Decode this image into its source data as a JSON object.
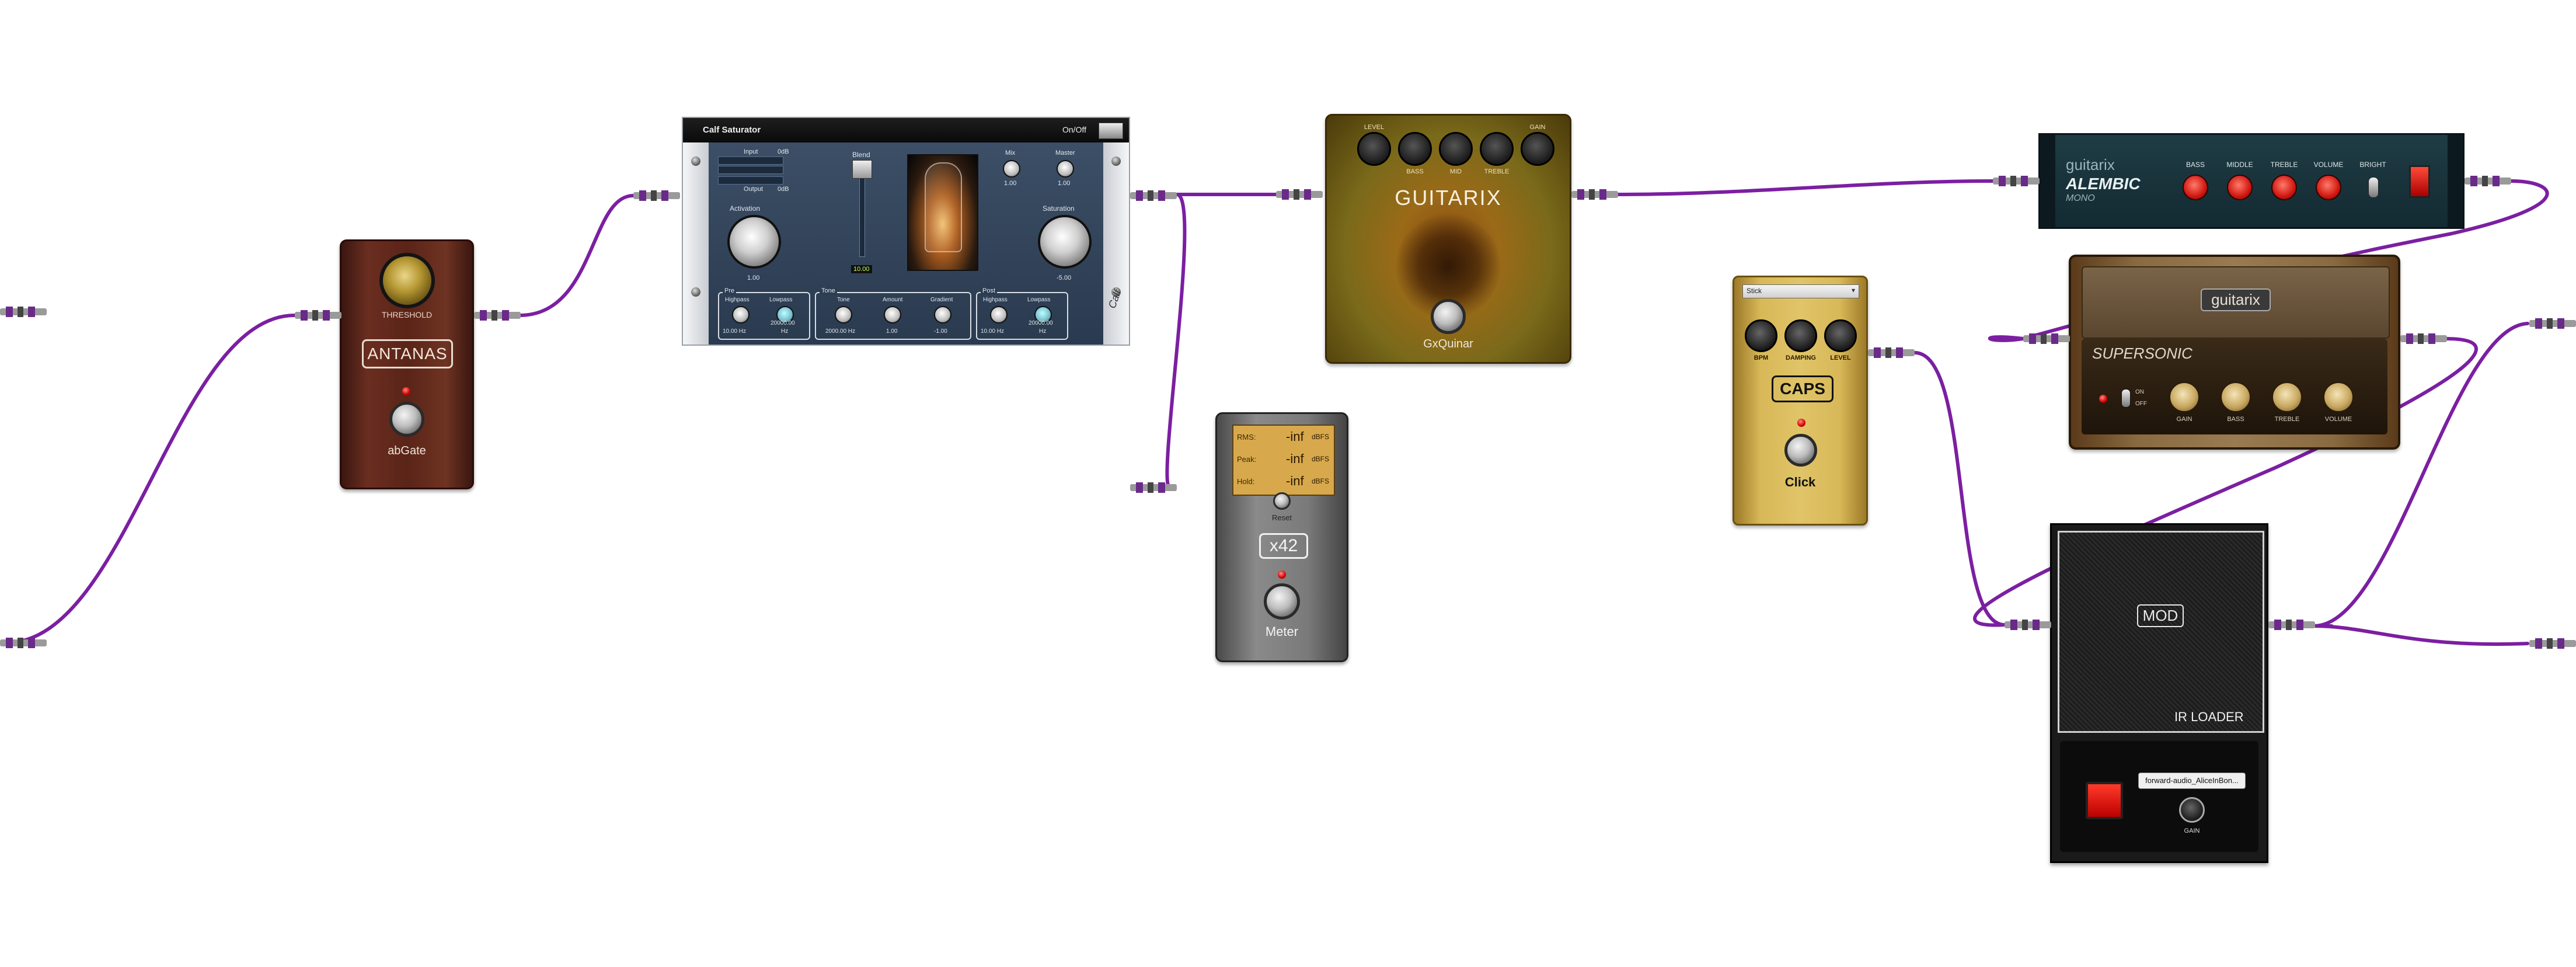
{
  "colors": {
    "cable": "#7b1fa2",
    "background": "#ffffff"
  },
  "plugins": {
    "abgate": {
      "name": "abGate",
      "title": "ANTANAS",
      "knob_label": "THRESHOLD"
    },
    "calf_saturator": {
      "title": "Calf Saturator",
      "onoff": "On/Off",
      "input_label": "Input",
      "output_label": "Output",
      "l_label": "L",
      "r_label": "R",
      "db_neg": "-12",
      "db_zero": "0",
      "input_gain": "0dB",
      "output_gain": "0dB",
      "blend_label": "Blend",
      "blend_value": "10.00",
      "mix_label": "Mix",
      "mix_value": "1.00",
      "master_label": "Master",
      "master_value": "1.00",
      "activation_label": "Activation",
      "activation_value": "1.00",
      "saturation_label": "Saturation",
      "saturation_value": "-5.00",
      "pre_label": "Pre",
      "highpass_label": "Highpass",
      "lowpass_label": "Lowpass",
      "pre_hp_value": "10.00 Hz",
      "pre_lp_value": "20000.00",
      "hz": "Hz",
      "tone_label": "Tone",
      "tone_knob_label": "Tone",
      "amount_label": "Amount",
      "gradient_label": "Gradient",
      "tone_value": "2000.00 Hz",
      "amount_value": "1.00",
      "gradient_value": "-1.00",
      "post_label": "Post",
      "post_hp_value": "10.00 Hz",
      "post_lp_value": "20000.00",
      "brand": "Calf"
    },
    "gxquinar": {
      "name": "GxQuinar",
      "brand": "GUITARIX",
      "knob_labels": [
        "LEVEL",
        "BASS",
        "MID",
        "TREBLE",
        "GAIN"
      ]
    },
    "meter": {
      "name": "Meter",
      "title": "x42",
      "rows": [
        {
          "label": "RMS:",
          "value": "-inf",
          "unit": "dBFS"
        },
        {
          "label": "Peak:",
          "value": "-inf",
          "unit": "dBFS"
        },
        {
          "label": "Hold:",
          "value": "-inf",
          "unit": "dBFS"
        }
      ],
      "reset_label": "Reset"
    },
    "caps_click": {
      "name": "Click",
      "title": "CAPS",
      "preset": "Stick",
      "knob_labels": [
        "BPM",
        "DAMPING",
        "LEVEL"
      ]
    },
    "alembic": {
      "brand": "guitarix",
      "model": "ALEMBIC",
      "sub": "MONO",
      "knob_labels": [
        "BASS",
        "MIDDLE",
        "TREBLE",
        "VOLUME"
      ],
      "switch_label": "BRIGHT"
    },
    "supersonic": {
      "brand": "guitarix",
      "model": "SUPERSONIC",
      "switch_on": "ON",
      "switch_off": "OFF",
      "knob_labels": [
        "GAIN",
        "BASS",
        "TREBLE",
        "VOLUME"
      ]
    },
    "ir_loader": {
      "title": "IR LOADER",
      "brand": "MOD",
      "file": "forward-audio_AliceInBon...",
      "gain_label": "GAIN"
    }
  }
}
